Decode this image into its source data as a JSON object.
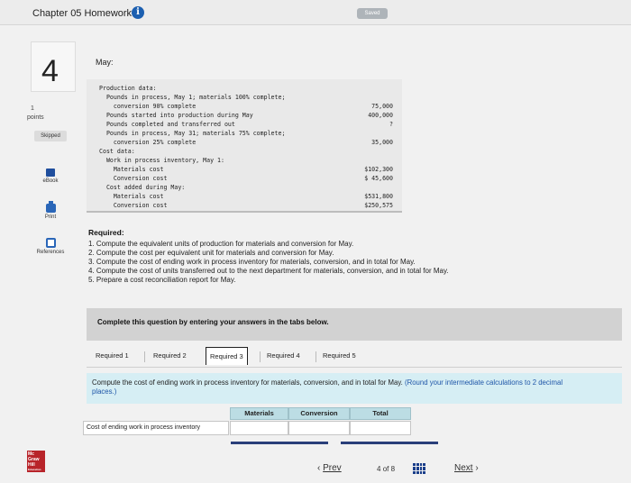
{
  "header": {
    "title": "Chapter 05 Homework",
    "saved": "Saved"
  },
  "sidebar": {
    "question_number": "4",
    "points_value": "1",
    "points_label": "points",
    "status": "Skipped",
    "tools": [
      {
        "label": "eBook"
      },
      {
        "label": "Print"
      },
      {
        "label": "References"
      }
    ],
    "logo": [
      "Mc",
      "Graw",
      "Hill",
      "Education"
    ]
  },
  "problem": {
    "intro": "May:",
    "data_lines": [
      {
        "text": "Production data:",
        "value": ""
      },
      {
        "text": "  Pounds in process, May 1; materials 100% complete;",
        "value": ""
      },
      {
        "text": "    conversion 90% complete",
        "value": "75,000"
      },
      {
        "text": "  Pounds started into production during May",
        "value": "400,000"
      },
      {
        "text": "  Pounds completed and transferred out",
        "value": "?"
      },
      {
        "text": "  Pounds in process, May 31; materials 75% complete;",
        "value": ""
      },
      {
        "text": "    conversion 25% complete",
        "value": "35,000"
      },
      {
        "text": "Cost data:",
        "value": ""
      },
      {
        "text": "  Work in process inventory, May 1:",
        "value": ""
      },
      {
        "text": "    Materials cost",
        "value": "$102,300"
      },
      {
        "text": "    Conversion cost",
        "value": "$ 45,600"
      },
      {
        "text": "  Cost added during May:",
        "value": ""
      },
      {
        "text": "    Materials cost",
        "value": "$531,800"
      },
      {
        "text": "    Conversion cost",
        "value": "$250,575"
      }
    ],
    "required_heading": "Required:",
    "required_items": [
      "1. Compute the equivalent units of production for materials and conversion for May.",
      "2. Compute the cost per equivalent unit for materials and conversion for May.",
      "3. Compute the cost of ending work in process inventory for materials, conversion, and in total for May.",
      "4. Compute the cost of units transferred out to the next department for materials, conversion, and in total for May.",
      "5. Prepare a cost reconciliation report for May."
    ]
  },
  "complete_banner": "Complete this question by entering your answers in the tabs below.",
  "tabs": [
    {
      "label": "Required 1",
      "active": false
    },
    {
      "label": "Required 2",
      "active": false
    },
    {
      "label": "Required 3",
      "active": true
    },
    {
      "label": "Required 4",
      "active": false
    },
    {
      "label": "Required 5",
      "active": false
    }
  ],
  "instruction": {
    "main": "Compute the cost of ending work in process inventory for materials, conversion, and in total for May. ",
    "note": "(Round your intermediate calculations to 2 decimal places.)"
  },
  "answer_table": {
    "columns": [
      "Materials",
      "Conversion",
      "Total"
    ],
    "row_label": "Cost of ending work in process inventory",
    "values": [
      "",
      "",
      ""
    ]
  },
  "navigation": {
    "prev": "Prev",
    "page_current": "4",
    "page_of": "of",
    "page_total": "8",
    "next": "Next"
  },
  "colors": {
    "accent": "#1c5fb0",
    "banner": "#d2d2d2",
    "instruction_bg": "#d6eef4",
    "column_header": "#bcdde4"
  }
}
